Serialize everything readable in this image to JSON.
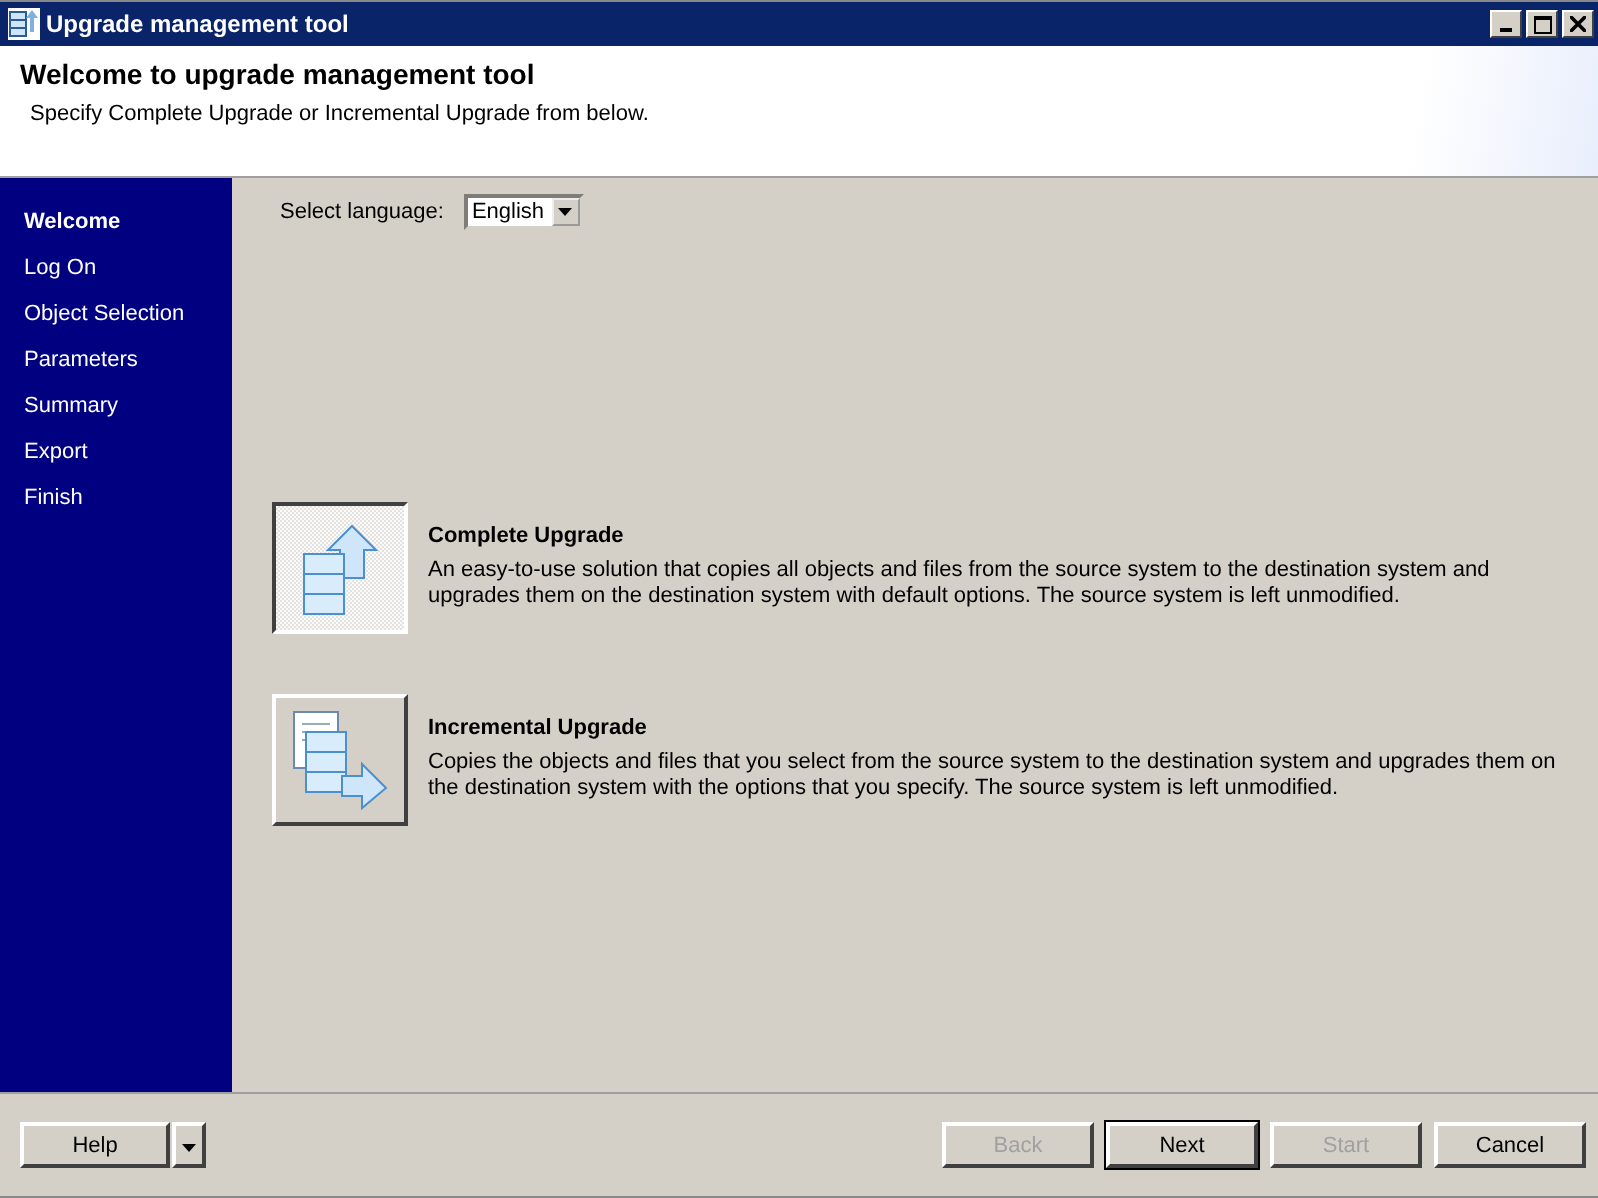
{
  "window": {
    "title": "Upgrade management tool"
  },
  "header": {
    "title": "Welcome to upgrade management tool",
    "subtitle": "Specify Complete Upgrade or Incremental Upgrade from below."
  },
  "sidebar": {
    "items": [
      {
        "label": "Welcome",
        "selected": true
      },
      {
        "label": "Log On",
        "selected": false
      },
      {
        "label": "Object Selection",
        "selected": false
      },
      {
        "label": "Parameters",
        "selected": false
      },
      {
        "label": "Summary",
        "selected": false
      },
      {
        "label": "Export",
        "selected": false
      },
      {
        "label": "Finish",
        "selected": false
      }
    ]
  },
  "language": {
    "label": "Select language:",
    "value": "English"
  },
  "options": [
    {
      "kind": "complete",
      "title": "Complete Upgrade",
      "description": "An easy-to-use solution that copies all objects and files from the source system to the destination system and upgrades them on the destination system with default options.  The source system is left unmodified.",
      "selected": true
    },
    {
      "kind": "incremental",
      "title": "Incremental Upgrade",
      "description": "Copies the objects and files that you select from the source system to the destination system and upgrades them on the destination system with the options that you specify.  The source system is left unmodified.",
      "selected": false
    }
  ],
  "footer": {
    "help": "Help",
    "buttons": [
      {
        "label": "Back",
        "disabled": true,
        "default": false
      },
      {
        "label": "Next",
        "disabled": false,
        "default": true
      },
      {
        "label": "Start",
        "disabled": true,
        "default": false
      },
      {
        "label": "Cancel",
        "disabled": false,
        "default": false
      }
    ]
  }
}
